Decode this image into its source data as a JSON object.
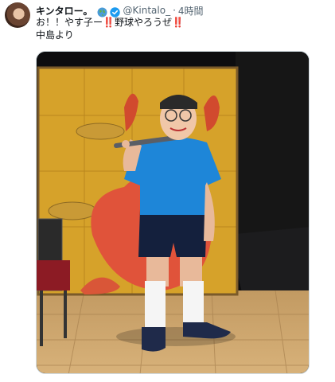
{
  "tweet": {
    "author_name": "キンタロー。",
    "handle": "@Kintalo_",
    "separator": "·",
    "time": "4時間",
    "text_line1": "お！！やす子ー‼️野球やろうぜ‼️",
    "text_line2": "中島より"
  },
  "icons": {
    "globe": "globe-icon",
    "verified": "verified-badge-icon"
  },
  "colors": {
    "verified": "#1d9bf0",
    "handle": "#536471"
  }
}
